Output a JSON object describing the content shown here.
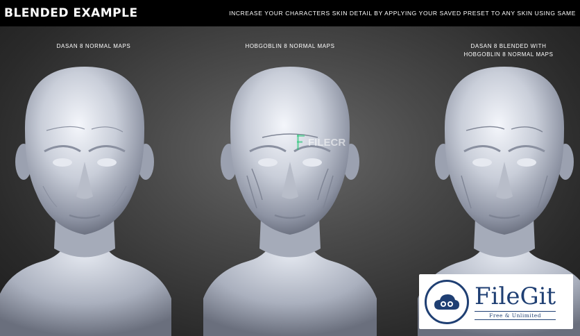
{
  "header": {
    "title": "BLENDED EXAMPLE",
    "tagline": "INCREASE YOUR CHARACTERS SKIN DETAIL BY APPLYING YOUR SAVED PRESET TO ANY SKIN USING SAME"
  },
  "panels": [
    {
      "caption_line1": "DASAN 8 NORMAL MAPS",
      "caption_line2": ""
    },
    {
      "caption_line1": "HOBGOBLIN 8 NORMAL MAPS",
      "caption_line2": ""
    },
    {
      "caption_line1": "DASAN 8 BLENDED WITH",
      "caption_line2": "HOBGOBLIN 8 NORMAL MAPS"
    }
  ],
  "watermark": {
    "text": "FILECR"
  },
  "logo": {
    "name": "FileGit",
    "subtitle": "Free & Unlimited"
  },
  "colors": {
    "bar": "#000000",
    "text": "#ffffff",
    "logo_blue": "#1f3f73",
    "head_tone": "#c9ced9"
  }
}
